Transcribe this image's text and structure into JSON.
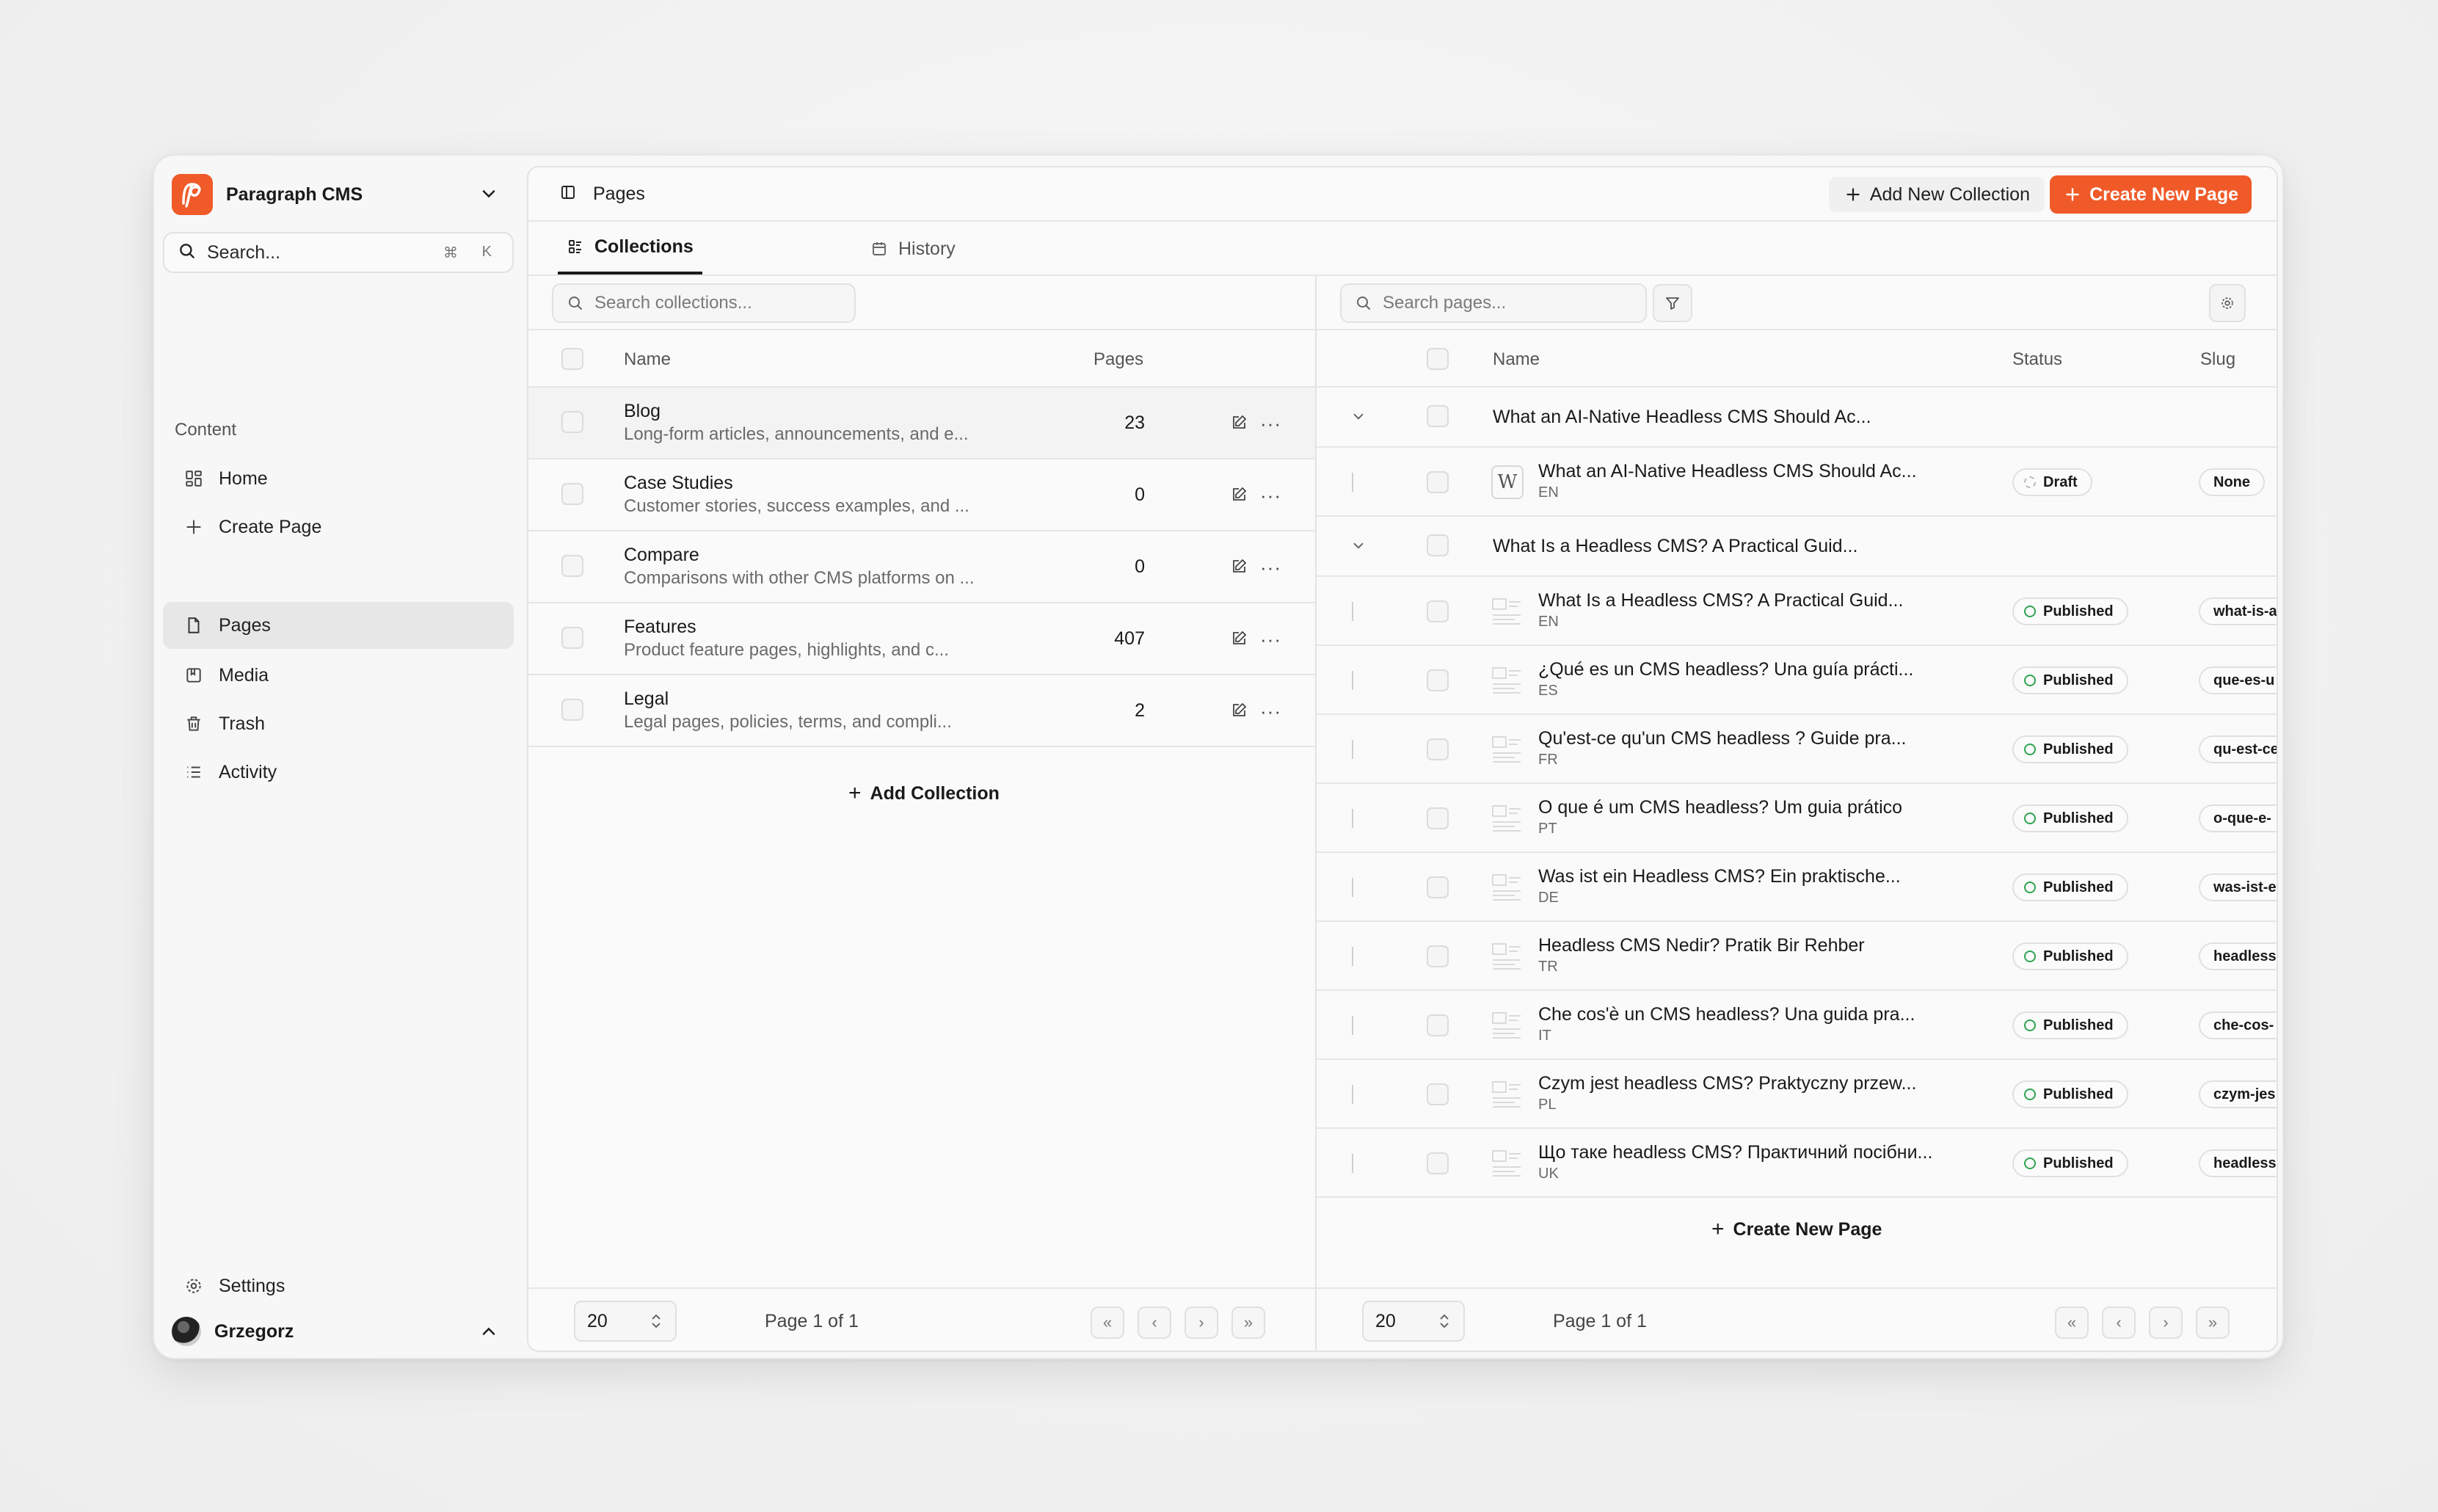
{
  "app": {
    "name": "Paragraph CMS"
  },
  "sidebar": {
    "search_label": "Search...",
    "shortcut_mod": "⌘",
    "shortcut_key": "K",
    "nav": [
      {
        "label": "Home",
        "icon": "dashboard-icon"
      },
      {
        "label": "Create Page",
        "icon": "plus-icon"
      }
    ],
    "section_label": "Content",
    "content_nav": [
      {
        "label": "Pages",
        "icon": "file-icon",
        "active": true
      },
      {
        "label": "Media",
        "icon": "image-icon"
      },
      {
        "label": "Trash",
        "icon": "trash-icon"
      },
      {
        "label": "Activity",
        "icon": "list-icon"
      }
    ],
    "settings_label": "Settings",
    "user_name": "Grzegorz"
  },
  "header": {
    "title": "Pages",
    "add_collection_label": "Add New Collection",
    "create_page_label": "Create New Page"
  },
  "tabs": [
    {
      "label": "Collections",
      "active": true
    },
    {
      "label": "History",
      "active": false
    }
  ],
  "collections": {
    "search_placeholder": "Search collections...",
    "columns": {
      "name": "Name",
      "pages": "Pages"
    },
    "rows": [
      {
        "name": "Blog",
        "description": "Long-form articles, announcements, and e...",
        "pages": "23"
      },
      {
        "name": "Case Studies",
        "description": "Customer stories, success examples, and ...",
        "pages": "0"
      },
      {
        "name": "Compare",
        "description": "Comparisons with other CMS platforms on ...",
        "pages": "0"
      },
      {
        "name": "Features",
        "description": "Product feature pages, highlights, and c...",
        "pages": "407"
      },
      {
        "name": "Legal",
        "description": "Legal pages, policies, terms, and compli...",
        "pages": "2"
      }
    ],
    "add_label": "Add Collection",
    "footer": {
      "page_size": "20",
      "page_text": "Page 1 of 1"
    }
  },
  "pages": {
    "search_placeholder": "Search pages...",
    "columns": {
      "name": "Name",
      "status": "Status",
      "slug": "Slug"
    },
    "groups": [
      {
        "title": "What an AI-Native Headless CMS Should Ac...",
        "items": [
          {
            "title": "What an AI-Native Headless CMS Should Ac...",
            "lang": "EN",
            "status": "Draft",
            "slug": "None",
            "thumb": "W"
          }
        ]
      },
      {
        "title": "What Is a Headless CMS? A Practical Guid...",
        "items": [
          {
            "title": "What Is a Headless CMS? A Practical Guid...",
            "lang": "EN",
            "status": "Published",
            "slug": "what-is-a"
          },
          {
            "title": "¿Qué es un CMS headless? Una guía prácti...",
            "lang": "ES",
            "status": "Published",
            "slug": "que-es-u"
          },
          {
            "title": "Qu'est-ce qu'un CMS headless ? Guide pra...",
            "lang": "FR",
            "status": "Published",
            "slug": "qu-est-ce"
          },
          {
            "title": "O que é um CMS headless? Um guia prático",
            "lang": "PT",
            "status": "Published",
            "slug": "o-que-e-"
          },
          {
            "title": "Was ist ein Headless CMS? Ein praktische...",
            "lang": "DE",
            "status": "Published",
            "slug": "was-ist-e"
          },
          {
            "title": "Headless CMS Nedir? Pratik Bir Rehber",
            "lang": "TR",
            "status": "Published",
            "slug": "headless"
          },
          {
            "title": "Che cos'è un CMS headless? Una guida pra...",
            "lang": "IT",
            "status": "Published",
            "slug": "che-cos-"
          },
          {
            "title": "Czym jest headless CMS? Praktyczny przew...",
            "lang": "PL",
            "status": "Published",
            "slug": "czym-jes"
          },
          {
            "title": "Що таке headless CMS? Практичний посібни...",
            "lang": "UK",
            "status": "Published",
            "slug": "headless"
          }
        ]
      }
    ],
    "create_label": "Create New Page",
    "footer": {
      "page_size": "20",
      "page_text": "Page 1 of 1"
    }
  },
  "colors": {
    "accent": "#f05a28",
    "published": "#2ea44f",
    "active_nav": "#e7e7e7"
  }
}
